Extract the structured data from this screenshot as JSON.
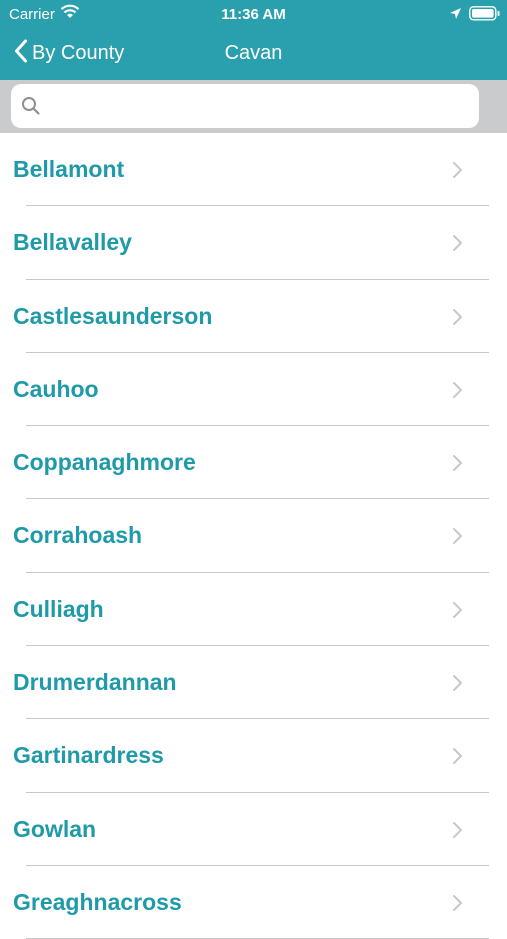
{
  "status_bar": {
    "carrier": "Carrier",
    "time": "11:36 AM"
  },
  "nav": {
    "back_label": "By County",
    "title": "Cavan"
  },
  "search": {
    "placeholder": ""
  },
  "list": {
    "items": [
      "Bellamont",
      "Bellavalley",
      "Castlesaunderson",
      "Cauhoo",
      "Coppanaghmore",
      "Corrahoash",
      "Culliagh",
      "Drumerdannan",
      "Gartinardress",
      "Gowlan",
      "Greaghnacross"
    ]
  },
  "colors": {
    "header": "#2a9fae",
    "item_text": "#1f9aa8",
    "search_bg": "#cacbcd"
  },
  "icons": [
    "wifi-icon",
    "location-arrow-icon",
    "battery-icon",
    "chevron-left-icon",
    "search-icon",
    "chevron-right-icon"
  ]
}
